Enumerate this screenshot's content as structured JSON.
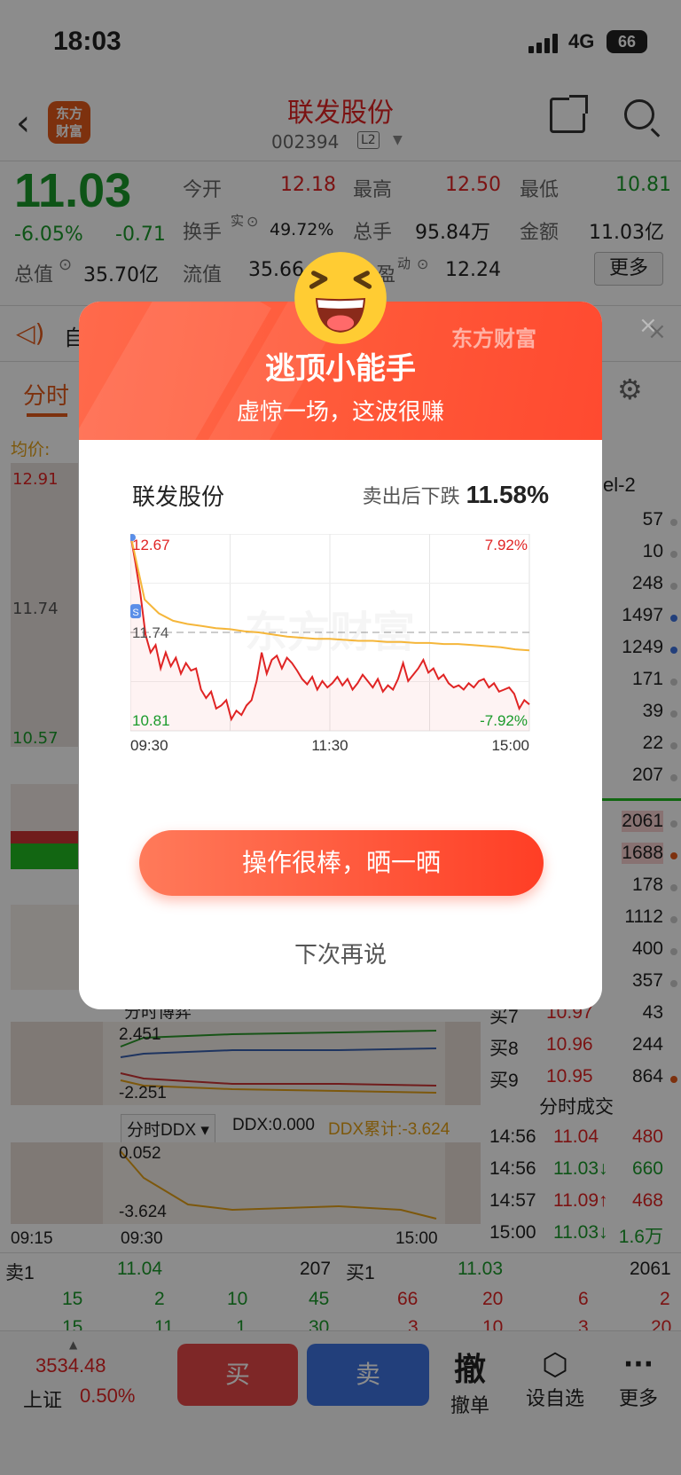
{
  "status_bar": {
    "time": "18:03",
    "network": "4G",
    "battery": "66"
  },
  "nav": {
    "stock_name": "联发股份",
    "stock_code": "002394",
    "level": "L2",
    "logo_text": "东方\n财富"
  },
  "quote": {
    "price": "11.03",
    "change_pct": "-6.05%",
    "change_amt": "-0.71",
    "open_label": "今开",
    "open": "12.18",
    "high_label": "最高",
    "high": "12.50",
    "low_label": "最低",
    "low": "10.81",
    "turnover_label": "换手",
    "turnover_sup": "实",
    "turnover": "49.72%",
    "volume_label": "总手",
    "volume": "95.84万",
    "amount_label": "金额",
    "amount": "11.03亿",
    "mcap_label": "总值",
    "mcap": "35.70亿",
    "float_label": "流值",
    "float_val": "35.66",
    "pe_label": "盈",
    "pe_sup": "动",
    "pe": "12.24",
    "more_label": "更多"
  },
  "notice": {
    "text": "自"
  },
  "tabs": {
    "active": "分时"
  },
  "chart_bg": {
    "avg_label": "均价:",
    "top": "12.91",
    "mid": "11.74",
    "bottom": "10.57"
  },
  "orderbook": {
    "header": "el-2",
    "rows": [
      "57",
      "10",
      "248",
      "1497",
      "1249",
      "171",
      "39",
      "22",
      "207",
      "2061",
      "1688",
      "178",
      "1112",
      "400",
      "357",
      "43",
      "244",
      "864"
    ],
    "buy7_label": "买7",
    "buy7_price": "10.97",
    "buy8_label": "买8",
    "buy8_price": "10.96",
    "buy9_label": "买9",
    "buy9_price": "10.95"
  },
  "trades": {
    "title": "分时成交",
    "rows": [
      {
        "time": "14:56",
        "price": "11.04",
        "vol": "480"
      },
      {
        "time": "14:56",
        "price": "11.03↓",
        "vol": "660"
      },
      {
        "time": "14:57",
        "price": "11.09↑",
        "vol": "468"
      },
      {
        "time": "15:00",
        "price": "11.03↓",
        "vol": "1.6万"
      }
    ]
  },
  "indicators": {
    "bs_label": "分时博弈",
    "bs_top": "2.451",
    "bs_bottom": "-2.251",
    "ddx_label": "分时DDX",
    "ddx_value": "DDX:0.000",
    "ddx_cum": "DDX累计:-3.624",
    "ddx_top": "0.052",
    "ddx_bottom": "-3.624",
    "time_start": "09:15",
    "time_open": "09:30",
    "time_close": "15:00"
  },
  "book_bottom": {
    "sell_label": "卖1",
    "sell_price": "11.04",
    "sell_vol": "207",
    "buy_label": "买1",
    "buy_price": "11.03",
    "buy_vol": "2061",
    "row1_left": [
      "15",
      "2",
      "10",
      "45"
    ],
    "row1_right": [
      "66",
      "20",
      "6",
      "2"
    ],
    "row2_left": [
      "15",
      "11",
      "1",
      "30"
    ],
    "row2_right": [
      "3",
      "10",
      "3",
      "20"
    ]
  },
  "bottom_nav": {
    "index_value": "3534.48",
    "index_name": "上证",
    "index_pct": "0.50%",
    "buy": "买",
    "sell": "卖",
    "cancel_big": "撤",
    "cancel": "撤单",
    "watch": "设自选",
    "more": "更多"
  },
  "modal": {
    "watermark": "东方财富",
    "title": "逃顶小能手",
    "subtitle": "虚惊一场，这波很赚",
    "stock_name": "联发股份",
    "drop_label": "卖出后下跌",
    "drop_pct": "11.58%",
    "cta": "操作很棒，晒一晒",
    "later": "下次再说",
    "chart_watermark": "东方财富"
  },
  "chart_data": {
    "type": "line",
    "title": "",
    "x_ticks": [
      "09:30",
      "11:30",
      "15:00"
    ],
    "ylim": [
      10.81,
      12.67
    ],
    "y_labels_left": {
      "top": "12.67",
      "mid": "11.74",
      "bottom": "10.81"
    },
    "y_labels_right": {
      "top": "7.92%",
      "bottom": "-7.92%"
    },
    "reference": 11.74,
    "series": [
      {
        "values": [
          12.67,
          12.4,
          12.1,
          11.72,
          11.55,
          11.62,
          11.4,
          11.55,
          11.42,
          11.5,
          11.35,
          11.45,
          11.38,
          11.4,
          11.2,
          11.12,
          11.18,
          11.02,
          11.05,
          11.1,
          10.92,
          11.0,
          10.96,
          11.05,
          11.1,
          11.28,
          11.55,
          11.35,
          11.48,
          11.52,
          11.4,
          11.5,
          11.45,
          11.38,
          11.3,
          11.25,
          11.32,
          11.2,
          11.28,
          11.22,
          11.26,
          11.32,
          11.24,
          11.3,
          11.2,
          11.26,
          11.34,
          11.28,
          11.22,
          11.3,
          11.18,
          11.24,
          11.2,
          11.3,
          11.45,
          11.28,
          11.34,
          11.4,
          11.48,
          11.36,
          11.4,
          11.3,
          11.34,
          11.26,
          11.22,
          11.24,
          11.2,
          11.26,
          11.22,
          11.28,
          11.3,
          11.22,
          11.26,
          11.18,
          11.2,
          11.22,
          11.16,
          11.02,
          11.1,
          11.06
        ]
      },
      {
        "values": [
          12.67,
          12.05,
          11.92,
          11.85,
          11.82,
          11.8,
          11.78,
          11.77,
          11.75,
          11.74,
          11.72,
          11.7,
          11.69,
          11.68,
          11.68,
          11.67,
          11.66,
          11.66,
          11.65,
          11.65,
          11.64,
          11.64,
          11.63,
          11.63,
          11.62,
          11.61,
          11.6,
          11.58,
          11.57
        ]
      }
    ]
  }
}
